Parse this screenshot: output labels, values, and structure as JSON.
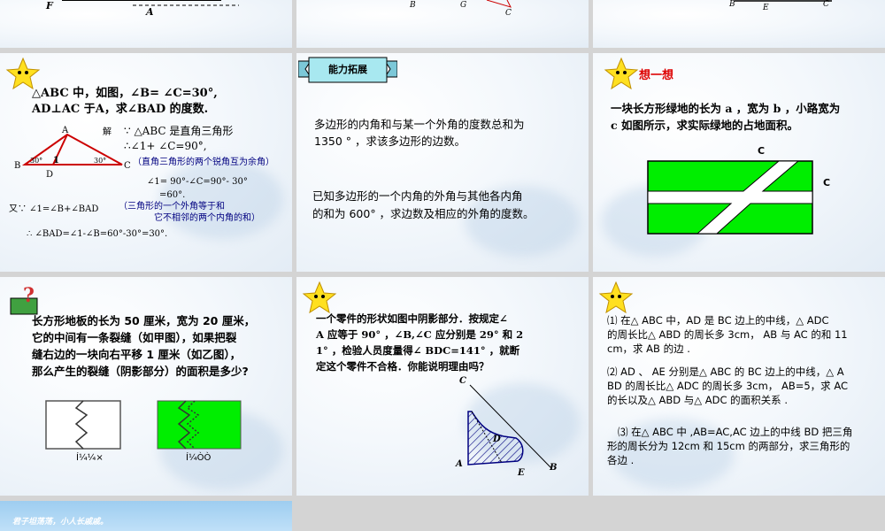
{
  "top_row": {
    "s1_labels": [
      "F",
      "A"
    ],
    "s2_labels": [
      "B",
      "G",
      "C"
    ],
    "s3_labels": [
      "B",
      "E",
      "C"
    ]
  },
  "slide4": {
    "problem_line1": "△ABC 中，如图，∠B= ∠C=30°,",
    "problem_line2": "AD⊥AC 于A，求∠BAD 的度数.",
    "fig_labels": {
      "A": "A",
      "B": "B",
      "C": "C",
      "D": "D",
      "one": "1",
      "ang_b": "30°",
      "ang_c": "30°"
    },
    "sol_jie": "解",
    "sol_line1": "∵ △ABC 是直角三角形",
    "sol_line2": "∴∠1+ ∠C=90°,",
    "sol_note1": "（直角三角形的两个锐角互为余角）",
    "sol_line3": "∠1= 90°-∠C=90°- 30°",
    "sol_line4": "=60°.",
    "sol_line5": "又∵ ∠1=∠B+∠BAD",
    "sol_note2a": "（三角形的一个外角等于和",
    "sol_note2b": "它不相邻的两个内角的和）",
    "sol_line6": "∴ ∠BAD=∠1-∠B=60°-30°=30°."
  },
  "slide5": {
    "banner": "能力拓展",
    "q1_line1": "多边形的内角和与某一个外角的度数总和为",
    "q1_line2": "1350 ° ，求该多边形的边数。",
    "q2_line1": "已知多边形的一个内角的外角与其他各内角",
    "q2_line2": "的和为 600° ，求边数及相应的外角的度数。"
  },
  "slide6": {
    "title": "想一想",
    "line1": "一块长方形绿地的长为 a ，宽为 b ，小路宽为",
    "line2": "c 如图所示，求实际绿地的占地面积。",
    "label_c1": "C",
    "label_c2": "C"
  },
  "slide7": {
    "line1": "长方形地板的长为 50 厘米，宽为 20 厘米，",
    "line2": "它的中间有一条裂缝（如甲图），如果把裂",
    "line3": "缝右边的一块向右平移 1 厘米（如乙图），",
    "line4": "那么产生的裂缝（阴影部分）的面积是多少?",
    "cap_left": "Í¼¼×",
    "cap_right": "Í¼ÒÒ"
  },
  "slide8": {
    "line1": "一个零件的形状如图中阴影部分．按规定∠",
    "line2": "A 应等于 90° ，∠B,∠C 应分别是 29° 和 2",
    "line3": "1° ，检验人员度量得∠ BDC=141° ，就断",
    "line4": "定这个零件不合格．你能说明理由吗？",
    "fig_labels": {
      "C": "C",
      "D": "D",
      "A": "A",
      "E": "E",
      "B": "B"
    }
  },
  "slide9": {
    "p1_line1": "⑴ 在△ ABC 中，AD 是 BC 边上的中线，△ ADC",
    "p1_line2": "的周长比△ ABD 的周长多 3cm， AB 与 AC 的和 11",
    "p1_line3": "cm，求 AB 的边 .",
    "p2_line1": "⑵ AD 、 AE 分别是△ ABC 的 BC 边上的中线，△ A",
    "p2_line2": "BD 的周长比△ ADC 的周长多 3cm， AB=5，求 AC",
    "p2_line3": "的长以及△ ABD 与△ ADC 的面积关系 .",
    "p3_line1": "⑶ 在△ ABC 中 ,AB=AC,AC 边上的中线 BD 把三角",
    "p3_line2": "形的周长分为 12cm 和 15cm 的两部分，求三角形的",
    "p3_line3": "各边 ."
  },
  "slide10": {
    "motto": "君子坦荡荡，小人长戚戚。"
  },
  "colors": {
    "green": "#00ee00",
    "red": "#dd0000",
    "blue": "#000080",
    "banner": "#a8e8f0"
  }
}
